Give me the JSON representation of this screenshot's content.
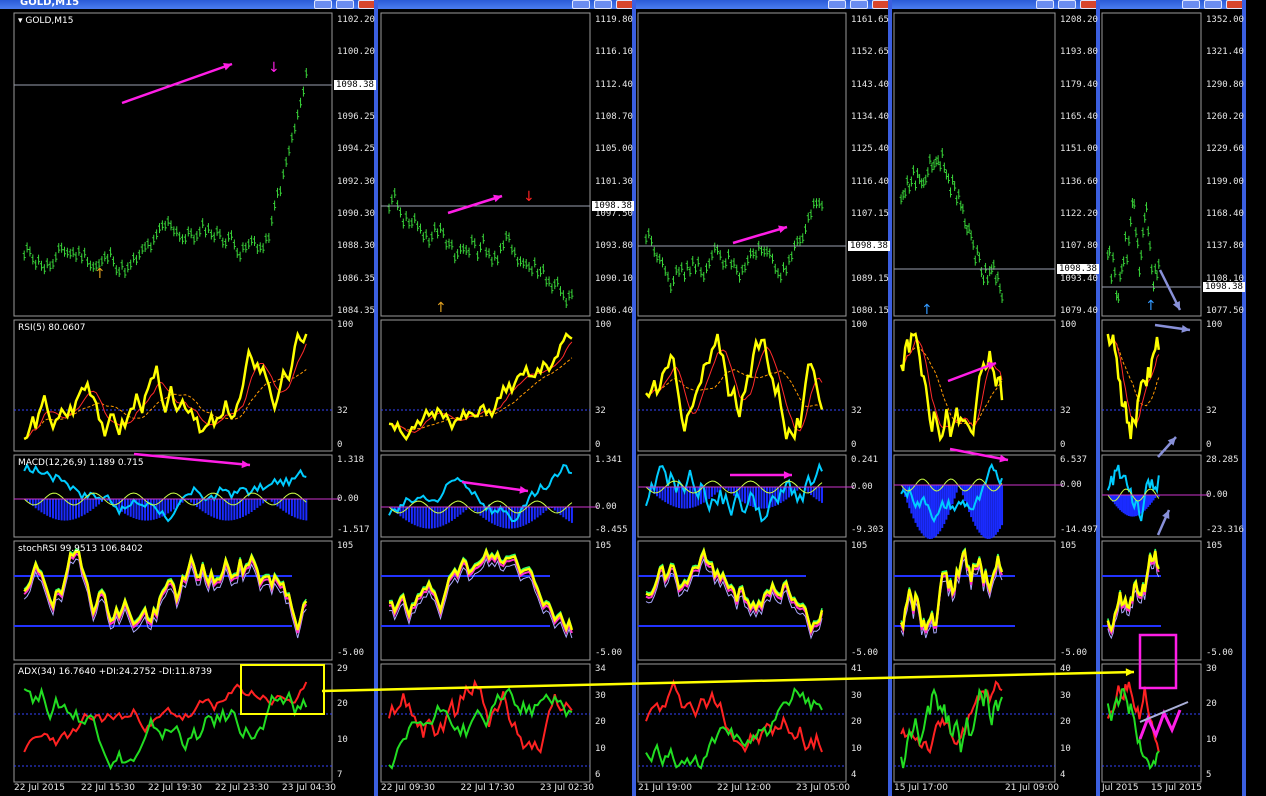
{
  "windows": [
    {
      "title": "GOLD,M15",
      "symbol_label": "GOLD,M15",
      "price_scale": [
        "1102.20",
        "1100.20",
        "1098.38",
        "1096.25",
        "1094.25",
        "1092.30",
        "1090.30",
        "1088.30",
        "1086.35",
        "1084.35"
      ],
      "current_price": "1098.38",
      "rsi_label": "RSI(5) 80.0607",
      "rsi_scale": [
        "100",
        "32",
        "0"
      ],
      "macd_label": "MACD(12,26,9) 1.189 0.715",
      "macd_scale": [
        "1.318",
        "0.00",
        "-1.517"
      ],
      "stoch_label": "stochRSI 99.9513 106.8402",
      "stoch_scale": [
        "105",
        "-5.00"
      ],
      "adx_label": "ADX(34) 16.7640 +DI:24.2752 -DI:11.8739",
      "adx_scale": [
        "29",
        "20",
        "10",
        "7"
      ],
      "time_axis": [
        "22 Jul 2015",
        "22 Jul 15:30",
        "22 Jul 19:30",
        "22 Jul 23:30",
        "23 Jul 04:30"
      ]
    },
    {
      "price_scale": [
        "1119.80",
        "1116.10",
        "1112.40",
        "1108.70",
        "1105.00",
        "1101.30",
        "1097.50",
        "1093.80",
        "1090.10",
        "1086.40"
      ],
      "current_price": "1098.38",
      "rsi_scale": [
        "100",
        "32",
        "0"
      ],
      "macd_scale": [
        "1.341",
        "0.00",
        "-8.455"
      ],
      "stoch_scale": [
        "105",
        "-5.00"
      ],
      "adx_scale": [
        "34",
        "30",
        "20",
        "10",
        "6"
      ],
      "time_axis": [
        "22 Jul 09:30",
        "22 Jul 17:30",
        "23 Jul 02:30"
      ]
    },
    {
      "price_scale": [
        "1161.65",
        "1152.65",
        "1143.40",
        "1134.40",
        "1125.40",
        "1116.40",
        "1107.15",
        "1098.38",
        "1089.15",
        "1080.15"
      ],
      "current_price": "1098.38",
      "rsi_scale": [
        "100",
        "32",
        "0"
      ],
      "macd_scale": [
        "0.241",
        "0.00",
        "-9.303"
      ],
      "stoch_scale": [
        "105",
        "-5.00"
      ],
      "adx_scale": [
        "41",
        "30",
        "20",
        "10",
        "4"
      ],
      "time_axis": [
        "21 Jul 19:00",
        "22 Jul 12:00",
        "23 Jul 05:00"
      ]
    },
    {
      "price_scale": [
        "1208.20",
        "1193.80",
        "1179.40",
        "1165.40",
        "1151.00",
        "1136.60",
        "1122.20",
        "1107.80",
        "1093.40",
        "1079.40"
      ],
      "current_price": "1098.38",
      "rsi_scale": [
        "100",
        "32",
        "0"
      ],
      "macd_scale": [
        "6.537",
        "0.00",
        "-14.497"
      ],
      "stoch_scale": [
        "105",
        "-5.00"
      ],
      "adx_scale": [
        "40",
        "30",
        "20",
        "10",
        "4"
      ],
      "time_axis": [
        "15 Jul 17:00",
        "21 Jul 09:00"
      ]
    },
    {
      "price_scale": [
        "1352.00",
        "1321.40",
        "1290.80",
        "1260.20",
        "1229.60",
        "1199.00",
        "1168.40",
        "1137.80",
        "1108.10",
        "1077.50"
      ],
      "current_price": "1098.38",
      "rsi_scale": [
        "100",
        "32",
        "0"
      ],
      "macd_scale": [
        "28.285",
        "0.00",
        "-23.316"
      ],
      "stoch_scale": [
        "105",
        "-5.00"
      ],
      "adx_scale": [
        "30",
        "20",
        "10",
        "5"
      ],
      "time_axis": [
        "Jul 2015",
        "15 Jul 2015"
      ]
    }
  ],
  "colors": {
    "price": "#39d439",
    "rsi": "#ffff00",
    "ma_red": "#ff2a2a",
    "ma_orange": "#ff9900",
    "macd_hist": "#1a2bff",
    "signal": "#00ccff",
    "annotation_magenta": "#ff1ee6",
    "annotation_yellow": "#ffff00",
    "di_plus": "#22dd22",
    "di_minus": "#ff2222"
  }
}
